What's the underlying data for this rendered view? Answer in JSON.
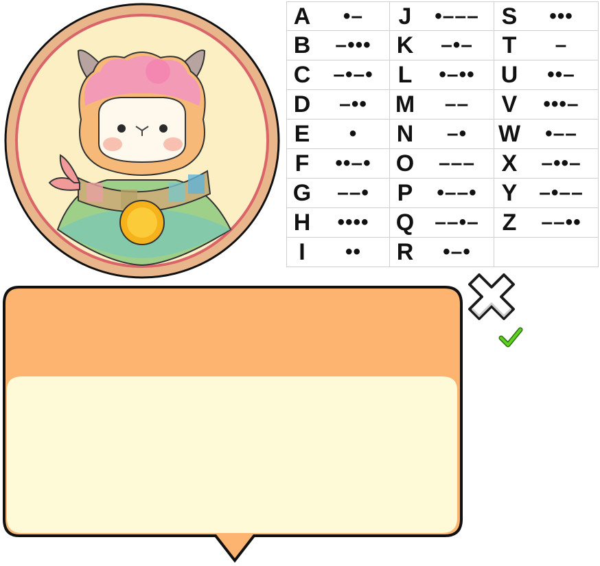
{
  "character": {
    "name_icon": "alpaca-avatar-icon"
  },
  "colors": {
    "frame_outer": "#e9b58a",
    "frame_ring": "#d9646a",
    "frame_bg": "#fcefc4",
    "dialog_header": "#fcb470",
    "dialog_body": "#fef9d6",
    "close_fill": "#ffffff",
    "check": "#4fbf2a"
  },
  "morse": [
    [
      {
        "letter": "A",
        "code": "•–"
      },
      {
        "letter": "J",
        "code": "•–––"
      },
      {
        "letter": "S",
        "code": "•••"
      }
    ],
    [
      {
        "letter": "B",
        "code": "–•••"
      },
      {
        "letter": "K",
        "code": "–•–"
      },
      {
        "letter": "T",
        "code": "–"
      }
    ],
    [
      {
        "letter": "C",
        "code": "–•–•"
      },
      {
        "letter": "L",
        "code": "•–••"
      },
      {
        "letter": "U",
        "code": "••–"
      }
    ],
    [
      {
        "letter": "D",
        "code": "–••"
      },
      {
        "letter": "M",
        "code": "––"
      },
      {
        "letter": "V",
        "code": "•••–"
      }
    ],
    [
      {
        "letter": "E",
        "code": "•"
      },
      {
        "letter": "N",
        "code": "–•"
      },
      {
        "letter": "W",
        "code": "•––"
      }
    ],
    [
      {
        "letter": "F",
        "code": "••–•"
      },
      {
        "letter": "O",
        "code": "–––"
      },
      {
        "letter": "X",
        "code": "–••–"
      }
    ],
    [
      {
        "letter": "G",
        "code": "––•"
      },
      {
        "letter": "P",
        "code": "•––•"
      },
      {
        "letter": "Y",
        "code": "–•––"
      }
    ],
    [
      {
        "letter": "H",
        "code": "••••"
      },
      {
        "letter": "Q",
        "code": "––•–"
      },
      {
        "letter": "Z",
        "code": "––••"
      }
    ],
    [
      {
        "letter": "I",
        "code": "••"
      },
      {
        "letter": "R",
        "code": "•–•"
      },
      {
        "letter": "",
        "code": ""
      }
    ]
  ],
  "dialog": {
    "header": "",
    "body": ""
  }
}
